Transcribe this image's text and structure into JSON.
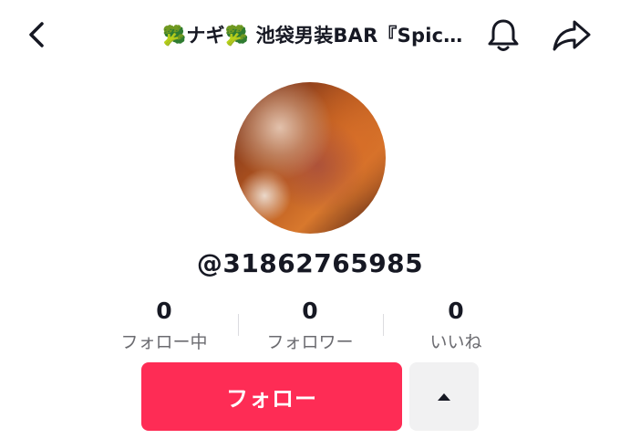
{
  "header": {
    "title": "🥦ナギ🥦 池袋男装BAR『Spic…",
    "back_icon": "chevron-left-icon",
    "bell_icon": "bell-icon",
    "share_icon": "share-arrow-icon"
  },
  "profile": {
    "username": "@31862765985"
  },
  "stats": [
    {
      "value": "0",
      "label": "フォロー中"
    },
    {
      "value": "0",
      "label": "フォロワー"
    },
    {
      "value": "0",
      "label": "いいね"
    }
  ],
  "actions": {
    "follow_label": "フォロー",
    "more_icon": "caret-up-icon",
    "follow_color": "#fe2c55"
  }
}
